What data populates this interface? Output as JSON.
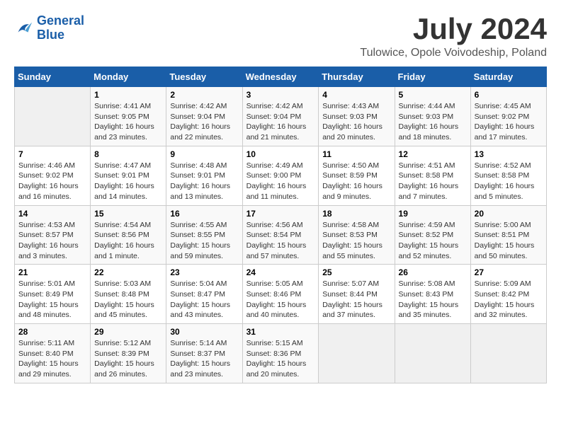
{
  "header": {
    "logo_line1": "General",
    "logo_line2": "Blue",
    "month": "July 2024",
    "location": "Tulowice, Opole Voivodeship, Poland"
  },
  "columns": [
    "Sunday",
    "Monday",
    "Tuesday",
    "Wednesday",
    "Thursday",
    "Friday",
    "Saturday"
  ],
  "weeks": [
    [
      {
        "num": "",
        "info": ""
      },
      {
        "num": "1",
        "info": "Sunrise: 4:41 AM\nSunset: 9:05 PM\nDaylight: 16 hours\nand 23 minutes."
      },
      {
        "num": "2",
        "info": "Sunrise: 4:42 AM\nSunset: 9:04 PM\nDaylight: 16 hours\nand 22 minutes."
      },
      {
        "num": "3",
        "info": "Sunrise: 4:42 AM\nSunset: 9:04 PM\nDaylight: 16 hours\nand 21 minutes."
      },
      {
        "num": "4",
        "info": "Sunrise: 4:43 AM\nSunset: 9:03 PM\nDaylight: 16 hours\nand 20 minutes."
      },
      {
        "num": "5",
        "info": "Sunrise: 4:44 AM\nSunset: 9:03 PM\nDaylight: 16 hours\nand 18 minutes."
      },
      {
        "num": "6",
        "info": "Sunrise: 4:45 AM\nSunset: 9:02 PM\nDaylight: 16 hours\nand 17 minutes."
      }
    ],
    [
      {
        "num": "7",
        "info": "Sunrise: 4:46 AM\nSunset: 9:02 PM\nDaylight: 16 hours\nand 16 minutes."
      },
      {
        "num": "8",
        "info": "Sunrise: 4:47 AM\nSunset: 9:01 PM\nDaylight: 16 hours\nand 14 minutes."
      },
      {
        "num": "9",
        "info": "Sunrise: 4:48 AM\nSunset: 9:01 PM\nDaylight: 16 hours\nand 13 minutes."
      },
      {
        "num": "10",
        "info": "Sunrise: 4:49 AM\nSunset: 9:00 PM\nDaylight: 16 hours\nand 11 minutes."
      },
      {
        "num": "11",
        "info": "Sunrise: 4:50 AM\nSunset: 8:59 PM\nDaylight: 16 hours\nand 9 minutes."
      },
      {
        "num": "12",
        "info": "Sunrise: 4:51 AM\nSunset: 8:58 PM\nDaylight: 16 hours\nand 7 minutes."
      },
      {
        "num": "13",
        "info": "Sunrise: 4:52 AM\nSunset: 8:58 PM\nDaylight: 16 hours\nand 5 minutes."
      }
    ],
    [
      {
        "num": "14",
        "info": "Sunrise: 4:53 AM\nSunset: 8:57 PM\nDaylight: 16 hours\nand 3 minutes."
      },
      {
        "num": "15",
        "info": "Sunrise: 4:54 AM\nSunset: 8:56 PM\nDaylight: 16 hours\nand 1 minute."
      },
      {
        "num": "16",
        "info": "Sunrise: 4:55 AM\nSunset: 8:55 PM\nDaylight: 15 hours\nand 59 minutes."
      },
      {
        "num": "17",
        "info": "Sunrise: 4:56 AM\nSunset: 8:54 PM\nDaylight: 15 hours\nand 57 minutes."
      },
      {
        "num": "18",
        "info": "Sunrise: 4:58 AM\nSunset: 8:53 PM\nDaylight: 15 hours\nand 55 minutes."
      },
      {
        "num": "19",
        "info": "Sunrise: 4:59 AM\nSunset: 8:52 PM\nDaylight: 15 hours\nand 52 minutes."
      },
      {
        "num": "20",
        "info": "Sunrise: 5:00 AM\nSunset: 8:51 PM\nDaylight: 15 hours\nand 50 minutes."
      }
    ],
    [
      {
        "num": "21",
        "info": "Sunrise: 5:01 AM\nSunset: 8:49 PM\nDaylight: 15 hours\nand 48 minutes."
      },
      {
        "num": "22",
        "info": "Sunrise: 5:03 AM\nSunset: 8:48 PM\nDaylight: 15 hours\nand 45 minutes."
      },
      {
        "num": "23",
        "info": "Sunrise: 5:04 AM\nSunset: 8:47 PM\nDaylight: 15 hours\nand 43 minutes."
      },
      {
        "num": "24",
        "info": "Sunrise: 5:05 AM\nSunset: 8:46 PM\nDaylight: 15 hours\nand 40 minutes."
      },
      {
        "num": "25",
        "info": "Sunrise: 5:07 AM\nSunset: 8:44 PM\nDaylight: 15 hours\nand 37 minutes."
      },
      {
        "num": "26",
        "info": "Sunrise: 5:08 AM\nSunset: 8:43 PM\nDaylight: 15 hours\nand 35 minutes."
      },
      {
        "num": "27",
        "info": "Sunrise: 5:09 AM\nSunset: 8:42 PM\nDaylight: 15 hours\nand 32 minutes."
      }
    ],
    [
      {
        "num": "28",
        "info": "Sunrise: 5:11 AM\nSunset: 8:40 PM\nDaylight: 15 hours\nand 29 minutes."
      },
      {
        "num": "29",
        "info": "Sunrise: 5:12 AM\nSunset: 8:39 PM\nDaylight: 15 hours\nand 26 minutes."
      },
      {
        "num": "30",
        "info": "Sunrise: 5:14 AM\nSunset: 8:37 PM\nDaylight: 15 hours\nand 23 minutes."
      },
      {
        "num": "31",
        "info": "Sunrise: 5:15 AM\nSunset: 8:36 PM\nDaylight: 15 hours\nand 20 minutes."
      },
      {
        "num": "",
        "info": ""
      },
      {
        "num": "",
        "info": ""
      },
      {
        "num": "",
        "info": ""
      }
    ]
  ]
}
